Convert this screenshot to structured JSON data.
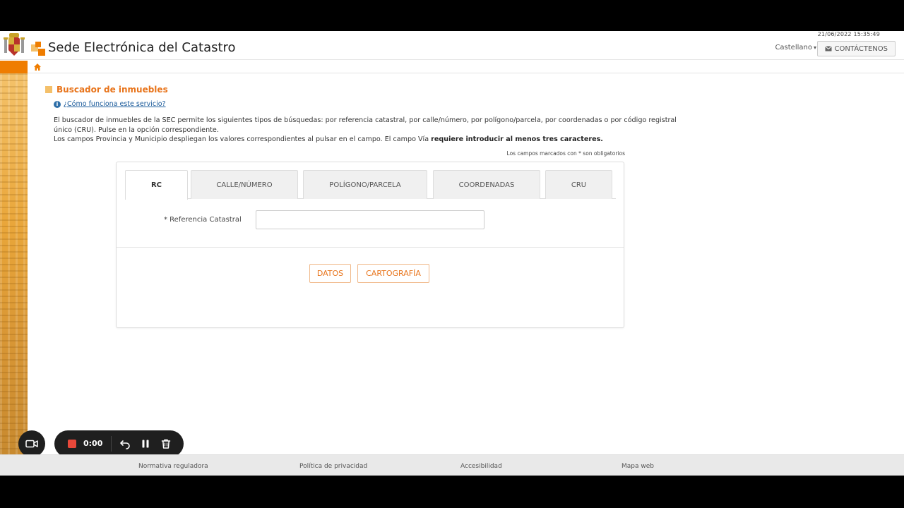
{
  "header": {
    "datetime": "21/06/2022  15:35:49",
    "site_title": "Sede Electrónica del Catastro",
    "language": "Castellano",
    "contact_label": "CONTÁCTENOS"
  },
  "main": {
    "section_title": "Buscador de inmuebles",
    "help_link": "¿Cómo funciona este servicio?",
    "desc_line1": "El buscador de inmuebles de la SEC permite los siguientes tipos de búsquedas: por referencia catastral, por calle/número, por polígono/parcela, por coordenadas o por código registral",
    "desc_line2": "único (CRU). Pulse en la opción correspondiente.",
    "desc_line3_plain": "Los campos Provincia y Municipio despliegan los valores correspondientes al pulsar en el campo. El campo Vía ",
    "desc_line3_bold": "requiere introducir al menos tres caracteres.",
    "required_note": "Los campos marcados con * son obligatorios"
  },
  "search": {
    "tabs": [
      "RC",
      "CALLE/NÚMERO",
      "POLÍGONO/PARCELA",
      "COORDENADAS",
      "CRU"
    ],
    "active_tab": "RC",
    "field_label": "* Referencia Catastral",
    "field_value": "",
    "datos_button": "DATOS",
    "cartografia_button": "CARTOGRAFÍA"
  },
  "recorder": {
    "time": "0:00"
  },
  "footer": {
    "links": [
      "Normativa reguladora",
      "Política de privacidad",
      "Accesibilidad",
      "Mapa web"
    ]
  },
  "colors": {
    "accent": "#e8741b",
    "brand_orange": "#ef7d00",
    "link": "#1a5a9a",
    "record": "#e8483a"
  }
}
